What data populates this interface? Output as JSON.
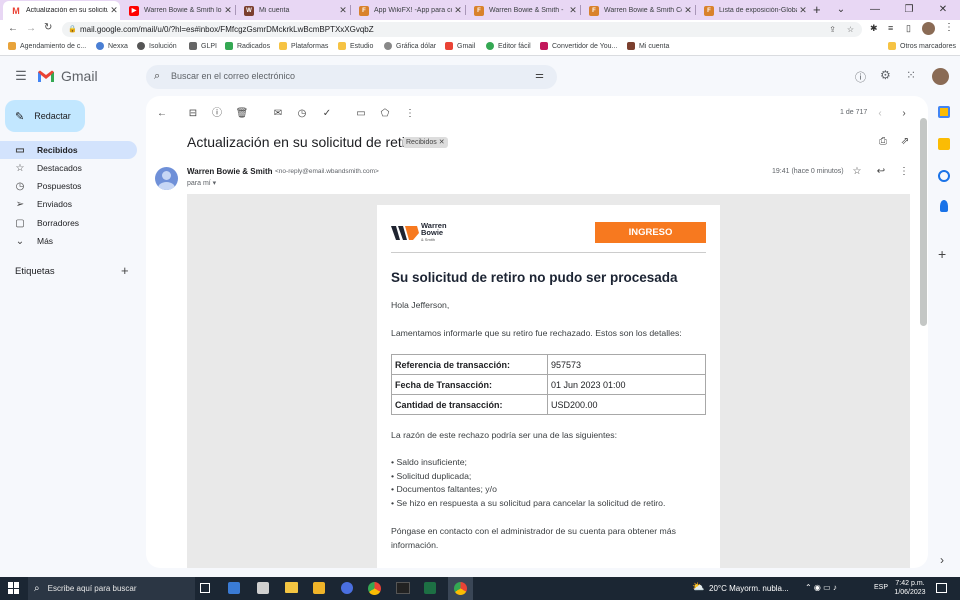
{
  "browser": {
    "tabs": [
      {
        "title": "Actualización en su solicitud",
        "favicon": "gmail-icon",
        "active": true
      },
      {
        "title": "Warren Bowie & Smith lo",
        "favicon": "youtube-icon",
        "active": false
      },
      {
        "title": "Mi cuenta",
        "favicon": "wb-icon",
        "active": false
      },
      {
        "title": "App WikiFX! -App para co",
        "favicon": "wikifx-icon",
        "active": false
      },
      {
        "title": "Warren Bowie & Smith -",
        "favicon": "wikifx-icon",
        "active": false
      },
      {
        "title": "Warren Bowie & Smith Co",
        "favicon": "wikifx-icon",
        "active": false
      },
      {
        "title": "Lista de exposición-Globa",
        "favicon": "wikifx-icon",
        "active": false
      }
    ],
    "url": "mail.google.com/mail/u/0/?hl=es#inbox/FMfcgzGsmrDMckrkLwBcmBPTXxXGvqbZ",
    "bookmarks": [
      "Agendamiento de c...",
      "Nexxa",
      "Isolución",
      "GLPI",
      "Radicados",
      "Plataformas",
      "Estudio",
      "Gráfica dólar",
      "Gmail",
      "Editor fácil",
      "Convertidor de You...",
      "Mi cuenta"
    ],
    "other_bookmarks": "Otros marcadores"
  },
  "gmail": {
    "logo": "Gmail",
    "search_placeholder": "Buscar en el correo electrónico",
    "compose": "Redactar",
    "nav": [
      {
        "label": "Recibidos",
        "icon": "inbox-icon",
        "selected": true
      },
      {
        "label": "Destacados",
        "icon": "star-icon",
        "selected": false
      },
      {
        "label": "Pospuestos",
        "icon": "clock-icon",
        "selected": false
      },
      {
        "label": "Enviados",
        "icon": "send-icon",
        "selected": false
      },
      {
        "label": "Borradores",
        "icon": "draft-icon",
        "selected": false
      },
      {
        "label": "Más",
        "icon": "chevron-down-icon",
        "selected": false
      }
    ],
    "labels_title": "Etiquetas",
    "pager": "1 de 717",
    "subject": "Actualización en su solicitud de retiro",
    "label_chip": "Recibidos",
    "sender_name": "Warren Bowie & Smith",
    "sender_email": "<no-reply@email.wbandsmith.com>",
    "to": "para mí",
    "time": "19:41 (hace 0 minutos)"
  },
  "email": {
    "logo_text_1": "Warren",
    "logo_text_2": "Bowie",
    "logo_text_3": "& Smith",
    "login_button": "INGRESO",
    "accent_color": "#f7791f",
    "heading": "Su solicitud de retiro no pudo ser procesada",
    "greeting": "Hola Jefferson,",
    "intro": "Lamentamos informarle que su retiro fue rechazado. Estos son los detalles:",
    "details": [
      {
        "key": "Referencia de transacción:",
        "value": "957573"
      },
      {
        "key": "Fecha de Transacción:",
        "value": "01 Jun 2023 01:00"
      },
      {
        "key": "Cantidad de transacción:",
        "value": "USD200.00"
      }
    ],
    "reasons_intro": "La razón de este rechazo podría ser una de las siguientes:",
    "reasons": [
      "• Saldo insuficiente;",
      "• Solicitud duplicada;",
      "• Documentos faltantes; y/o",
      "• Se hizo en respuesta a su solicitud para cancelar la solicitud de retiro."
    ],
    "contact": "Póngase en contacto con el administrador de su cuenta para obtener más información."
  },
  "taskbar": {
    "search_placeholder": "Escribe aquí para buscar",
    "weather": "20°C  Mayorm. nubla...",
    "lang": "ESP",
    "time": "7:42 p.m.",
    "date": "1/06/2023"
  }
}
